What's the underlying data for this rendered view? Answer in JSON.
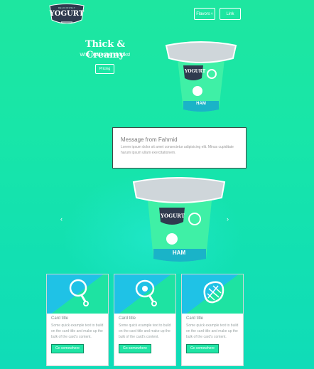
{
  "header": {
    "logo_top_text": "DELICIOUSLY",
    "logo_text": "YOGURT",
    "nav": [
      {
        "label": "Flavors"
      },
      {
        "label": "Link"
      }
    ]
  },
  "hero": {
    "title": "Thick & Creamy",
    "subtitle": "With real meat chunks!",
    "button_label": "Pricing",
    "cup_brand": "YOGURT",
    "cup_flavor": "HAM"
  },
  "message": {
    "title": "Message from Fahmid",
    "text": "Lorem ipsum dolor sit amet consectetur adipisicing elit. Minus cupiditate harum ipsum ullam exercitationem."
  },
  "carousel": {
    "prev_label": "‹",
    "next_label": "›",
    "cup_brand": "YOGURT",
    "cup_flavor": "HAM"
  },
  "cards": [
    {
      "icon": "drumstick-icon",
      "title": "Card title",
      "text": "Some quick example text to build on the card title and make up the bulk of the card's content.",
      "button": "Go somewhere"
    },
    {
      "icon": "ham-leg-icon",
      "title": "Card title",
      "text": "Some quick example text to build on the card title and make up the bulk of the card's content.",
      "button": "Go somewhere"
    },
    {
      "icon": "steak-icon",
      "title": "Card title",
      "text": "Some quick example text to build on the card title and make up the bulk of the card's content.",
      "button": "Go somewhere"
    }
  ],
  "colors": {
    "accent": "#1ee6a0",
    "card_header_blue": "#1fc2e6",
    "cup_dark": "#2f3a4e"
  }
}
